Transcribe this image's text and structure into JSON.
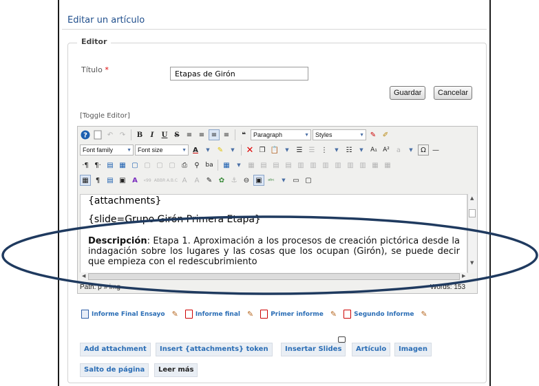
{
  "page": {
    "heading": "Editar un artículo",
    "legend": "Editor"
  },
  "form": {
    "title_label": "Título",
    "required_mark": "*",
    "title_value": "Etapas de Girón",
    "save_label": "Guardar",
    "cancel_label": "Cancelar",
    "toggle_editor": "[Toggle Editor]"
  },
  "toolbar": {
    "format_select": "Paragraph",
    "styles_select": "Styles",
    "font_family_select": "Font family",
    "font_size_select": "Font size"
  },
  "content": {
    "line1": "{attachments}",
    "line2": "{slide=Grupo Girón Primera Etapa}",
    "desc_label": "Descripción",
    "desc_text": ": Etapa 1. Aproximación a los procesos de creación pictórica desde la indagación sobre los  lugares y las cosas que los ocupan (Girón), se puede decir que empieza con el redescubrimiento"
  },
  "statusbar": {
    "path": "Path: p » img",
    "words": "Words: 153"
  },
  "attachments": [
    {
      "label": "Informe Final Ensayo",
      "type": "doc"
    },
    {
      "label": "Informe final",
      "type": "pdf"
    },
    {
      "label": "Primer informe",
      "type": "pdf"
    },
    {
      "label": "Segundo Informe",
      "type": "pdf"
    }
  ],
  "buttons": {
    "add_attachment": "Add attachment",
    "insert_token": "Insert {attachments} token",
    "insertar_slides": "Insertar Slides",
    "articulo": "Artículo",
    "imagen": "Imagen",
    "salto_pagina": "Salto de página",
    "leer_mas": "Leer más"
  },
  "colors": {
    "link": "#2a6db5",
    "heading": "#1f4e8c",
    "annotation": "#1f3a5f",
    "required": "#dd0000"
  }
}
